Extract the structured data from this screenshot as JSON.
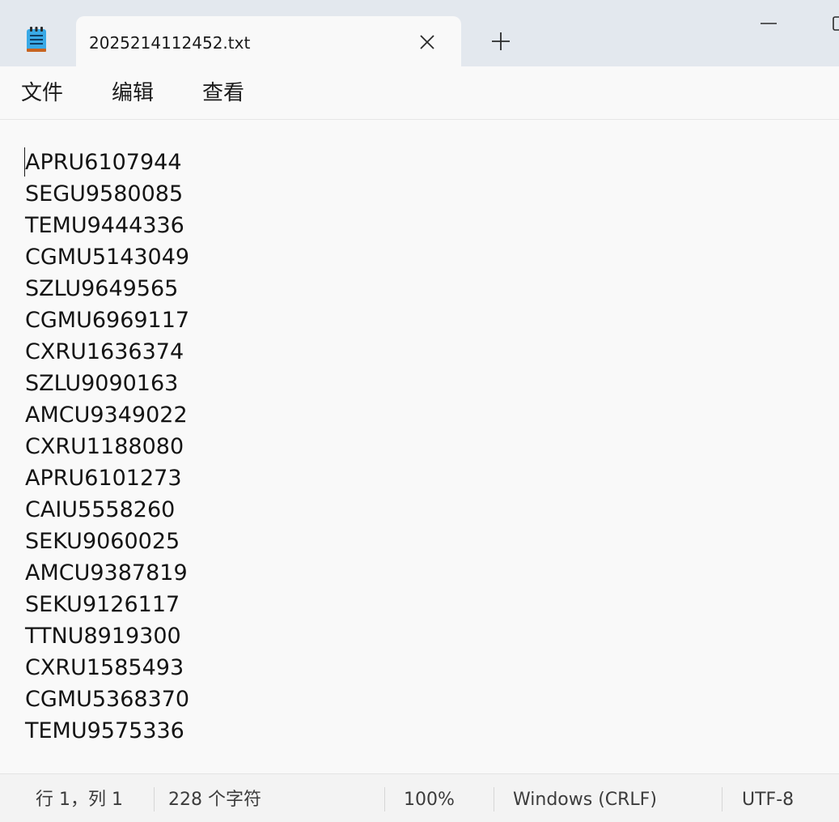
{
  "tab": {
    "title": "2025214112452.txt"
  },
  "menu": {
    "file": "文件",
    "edit": "编辑",
    "view": "查看"
  },
  "content": {
    "lines": [
      "APRU6107944",
      "SEGU9580085",
      "TEMU9444336",
      "CGMU5143049",
      "SZLU9649565",
      "CGMU6969117",
      "CXRU1636374",
      "SZLU9090163",
      "AMCU9349022",
      "CXRU1188080",
      "APRU6101273",
      "CAIU5558260",
      "SEKU9060025",
      "AMCU9387819",
      "SEKU9126117",
      "TTNU8919300",
      "CXRU1585493",
      "CGMU5368370",
      "TEMU9575336"
    ]
  },
  "status": {
    "position": "行 1，列 1",
    "char_count": "228 个字符",
    "zoom": "100%",
    "line_ending": "Windows (CRLF)",
    "encoding": "UTF-8"
  },
  "icons": {
    "app": "notepad-icon",
    "close": "close-icon",
    "add": "plus-icon",
    "minimize": "minimize-icon",
    "maximize": "maximize-icon"
  },
  "colors": {
    "accent": "#1e8fd6",
    "titlebar": "#e3e8ee",
    "editor_bg": "#f9f9f9"
  }
}
